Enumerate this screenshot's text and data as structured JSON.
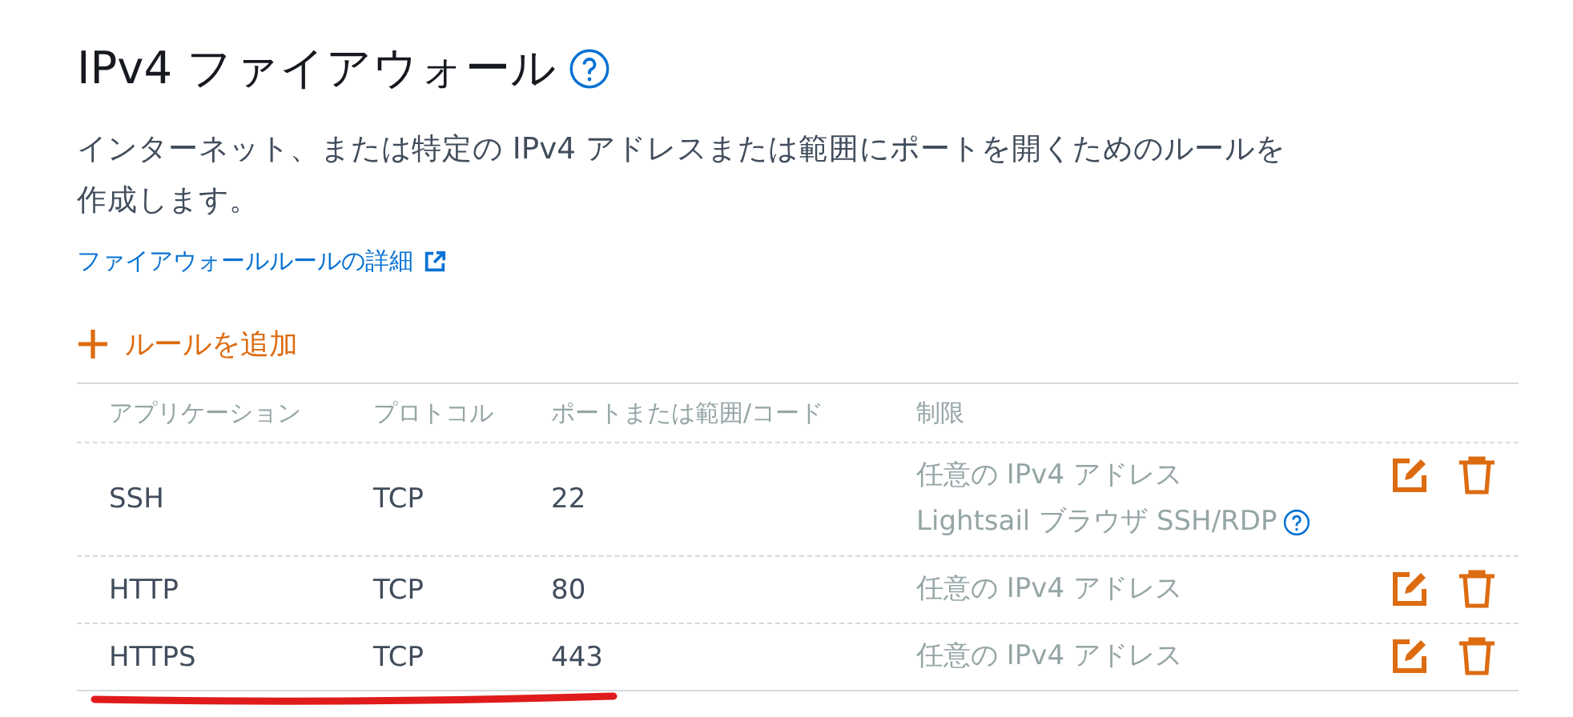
{
  "title": "IPv4 ファイアウォール",
  "description": "インターネット、または特定の IPv4 アドレスまたは範囲にポートを開くためのルールを作成します。",
  "details_link": "ファイアウォールルールの詳細",
  "add_rule": "ルールを追加",
  "table": {
    "columns": [
      "アプリケーション",
      "プロトコル",
      "ポートまたは範囲/コード",
      "制限"
    ],
    "rows": [
      {
        "application": "SSH",
        "protocol": "TCP",
        "port": "22",
        "restrictions": [
          {
            "text": "任意の IPv4 アドレス",
            "help": false
          },
          {
            "text": "Lightsail ブラウザ SSH/RDP",
            "help": true
          }
        ],
        "underlined": false
      },
      {
        "application": "HTTP",
        "protocol": "TCP",
        "port": "80",
        "restrictions": [
          {
            "text": "任意の IPv4 アドレス",
            "help": false
          }
        ],
        "underlined": false
      },
      {
        "application": "HTTPS",
        "protocol": "TCP",
        "port": "443",
        "restrictions": [
          {
            "text": "任意の IPv4 アドレス",
            "help": false
          }
        ],
        "underlined": true
      }
    ]
  }
}
